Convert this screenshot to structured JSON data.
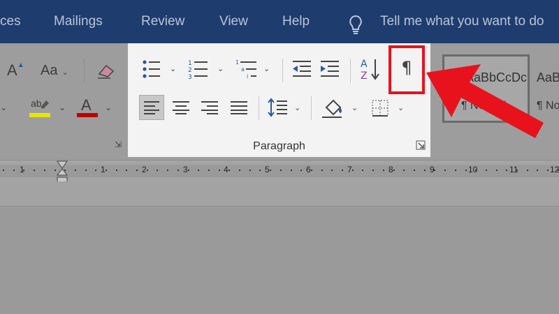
{
  "tabs": [
    {
      "label": "ces"
    },
    {
      "label": "Mailings"
    },
    {
      "label": "Review"
    },
    {
      "label": "View"
    },
    {
      "label": "Help"
    }
  ],
  "tell_me": {
    "text": "Tell me what you want to do",
    "icon": "lightbulb-icon"
  },
  "ribbon": {
    "font_group": {
      "change_case_label": "Aa",
      "grow_font_icon": "font-size-up-icon",
      "clear_formatting_icon": "eraser-icon",
      "highlight_label": "ab",
      "highlight_color": "#e6e600",
      "font_color_label": "A",
      "font_color": "#c00000"
    },
    "paragraph_group": {
      "label": "Paragraph",
      "bullets_icon": "bullets-icon",
      "numbering_icon": "numbering-icon",
      "multilevel_icon": "multilevel-list-icon",
      "decrease_indent_icon": "decrease-indent-icon",
      "increase_indent_icon": "increase-indent-icon",
      "sort_icon": "sort-az-icon",
      "show_hide_symbol": "¶",
      "align_left_icon": "align-left-icon",
      "center_icon": "align-center-icon",
      "align_right_icon": "align-right-icon",
      "justify_icon": "justify-icon",
      "line_spacing_icon": "line-spacing-icon",
      "shading_icon": "shading-icon",
      "borders_icon": "borders-icon"
    },
    "styles": {
      "normal_sample": "AaBbCcDc",
      "normal_name": "¶ Normal",
      "next_sample": "AaBbCcDc",
      "next_name": "¶ No"
    }
  },
  "ruler": {
    "numbers": [
      "1",
      "1",
      "2",
      "3",
      "4",
      "5",
      "6",
      "7",
      "8",
      "9",
      "10",
      "11",
      "12"
    ]
  },
  "colors": {
    "title_bar": "#1f3c6e",
    "highlight_red": "#e8121c"
  }
}
